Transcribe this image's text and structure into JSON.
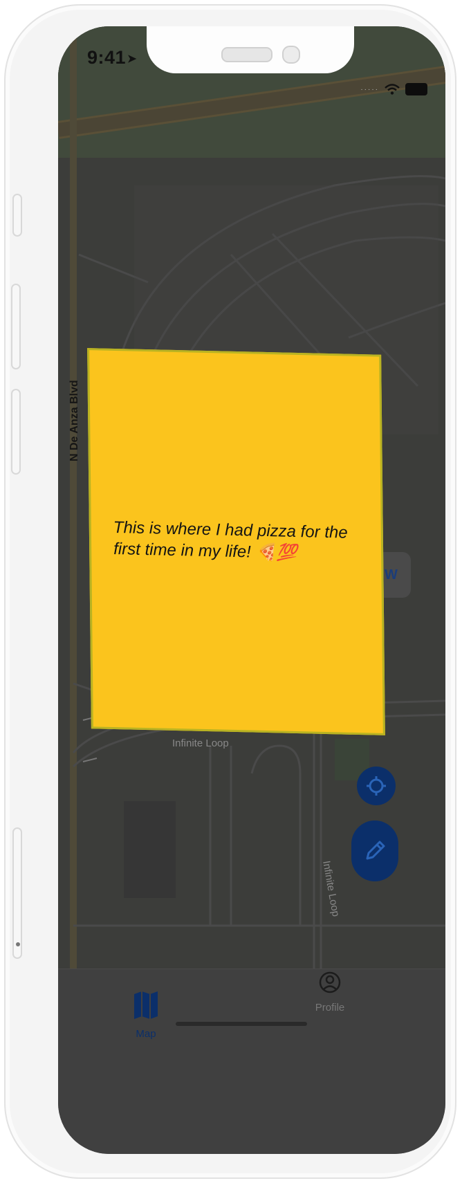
{
  "status_bar": {
    "time": "9:41",
    "signal": "·····"
  },
  "map": {
    "street_label": "N De Anza Blvd",
    "loop_label_h": "Infinite Loop",
    "loop_label_v": "Infinite Loop"
  },
  "note": {
    "text": "This is where I had pizza for the first time in my life! 🍕💯",
    "color": "#fbc41d"
  },
  "edge_chip": {
    "label": "W"
  },
  "fabs": {
    "locate_icon": "location-target-icon",
    "compose_icon": "pencil-icon",
    "color": "#0b2f6a"
  },
  "tab_bar": {
    "tabs": [
      {
        "label": "Map",
        "icon": "map-icon",
        "active": true,
        "color": "#0b2f6a"
      },
      {
        "label": "Profile",
        "icon": "person-circle-icon",
        "active": false,
        "color": "#777777"
      }
    ]
  }
}
